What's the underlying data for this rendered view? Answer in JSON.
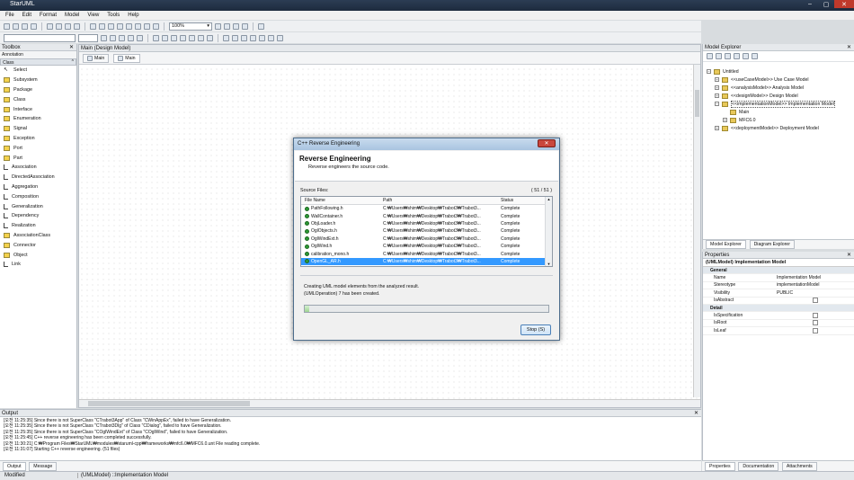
{
  "app": {
    "title": "StarUML"
  },
  "menu": [
    "File",
    "Edit",
    "Format",
    "Model",
    "View",
    "Tools",
    "Help"
  ],
  "zoom": "100%",
  "toolbox": {
    "title": "Toolbox",
    "section": "Annotation",
    "category": "Class",
    "items": [
      "Select",
      "Subsystem",
      "Package",
      "Class",
      "Interface",
      "Enumeration",
      "Signal",
      "Exception",
      "Port",
      "Part",
      "Association",
      "DirectedAssociation",
      "Aggregation",
      "Composition",
      "Generalization",
      "Dependency",
      "Realization",
      "AssociationClass",
      "Connector",
      "Object",
      "Link"
    ]
  },
  "editor": {
    "title": "Main (Design Model)",
    "tabs": [
      "Main",
      "Main"
    ]
  },
  "explorer": {
    "title": "Model Explorer",
    "tree": [
      {
        "label": "Untitled",
        "level": 0
      },
      {
        "label": "<<useCaseModel>> Use Case Model",
        "level": 1
      },
      {
        "label": "<<analysisModel>> Analysis Model",
        "level": 1
      },
      {
        "label": "<<designModel>> Design Model",
        "level": 1
      },
      {
        "label": "<<implementationModel>> Implementation Model",
        "level": 1
      },
      {
        "label": "Main",
        "level": 2
      },
      {
        "label": "MFC6.0",
        "level": 2
      },
      {
        "label": "<<deploymentModel>> Deployment Model",
        "level": 1
      }
    ],
    "tabs": [
      "Model Explorer",
      "Diagram Explorer"
    ]
  },
  "properties": {
    "title": "Properties",
    "header": "(UMLModel) Implementation Model",
    "general_label": "General",
    "detail_label": "Detail",
    "general": [
      {
        "k": "Name",
        "v": "Implementation Model"
      },
      {
        "k": "Stereotype",
        "v": "implementationModel"
      },
      {
        "k": "Visibility",
        "v": "PUBLIC"
      },
      {
        "k": "IsAbstract",
        "v": ""
      }
    ],
    "detail": [
      {
        "k": "IsSpecification",
        "v": ""
      },
      {
        "k": "IsRoot",
        "v": ""
      },
      {
        "k": "IsLeaf",
        "v": ""
      }
    ],
    "tabs": [
      "Properties",
      "Documentation",
      "Attachments"
    ]
  },
  "output": {
    "title": "Output",
    "lines": [
      "[오전 11:25:35]  Since there is not SuperClass \"CTrabot3App\" of Class \"CWinAppEx\", failed to have Generalization.",
      "[오전 11:25:35]  Since there is not SuperClass \"CTrabot3Dlg\" of Class \"CDialog\", failed to have Generalization.",
      "[오전 11:25:35]  Since there is not SuperClass \"COglWindExt\" of Class \"COglWind\", failed to have Generalization.",
      "[오전 11:25:45]  C++ reverse engineering has been completed successfully.",
      "[오전 11:30:21]  C:₩Program Files₩StarUML₩modules₩staruml-cpp₩frameworks₩mfc6.0₩MFC6.0.unt File reading complete.",
      "[오전 11:31:07]  Starting C++ reverse engineering. (51 files)"
    ],
    "tabs": [
      "Output",
      "Message"
    ]
  },
  "status": {
    "state": "Modified",
    "path": "(UMLModel) ::Implementation Model"
  },
  "dialog": {
    "title": "C++ Reverse Engineering",
    "heading": "Reverse Engineering",
    "subheading": "Reverse engineers the source code.",
    "source_label": "Source Files:",
    "count": "( 51 / 51 )",
    "columns": [
      "File Name",
      "Path",
      "Status"
    ],
    "files": [
      {
        "name": "PathFollowing.h",
        "path": "C:₩Users₩shim₩Desktop₩Trabot3₩Trabot3...",
        "status": "Complete"
      },
      {
        "name": "WallContainer.h",
        "path": "C:₩Users₩shim₩Desktop₩Trabot3₩Trabot3...",
        "status": "Complete"
      },
      {
        "name": "ObjLoader.h",
        "path": "C:₩Users₩shim₩Desktop₩Trabot3₩Trabot3...",
        "status": "Complete"
      },
      {
        "name": "OglObjects.h",
        "path": "C:₩Users₩shim₩Desktop₩Trabot3₩Trabot3...",
        "status": "Complete"
      },
      {
        "name": "OglWindExt.h",
        "path": "C:₩Users₩shim₩Desktop₩Trabot3₩Trabot3...",
        "status": "Complete"
      },
      {
        "name": "OglWind.h",
        "path": "C:₩Users₩shim₩Desktop₩Trabot3₩Trabot3...",
        "status": "Complete"
      },
      {
        "name": "calibration_mono.h",
        "path": "C:₩Users₩shim₩Desktop₩Trabot3₩Trabot3...",
        "status": "Complete"
      },
      {
        "name": "OpenGL_AR.h",
        "path": "C:₩Users₩shim₩Desktop₩Trabot3₩Trabot3...",
        "status": "Complete"
      }
    ],
    "selected_index": 7,
    "log": [
      "Creating UML model elements from the analyzed result.",
      "(UMLOperation) 7 has been created."
    ],
    "progress": 0.02,
    "stop_label": "Stop (S)"
  }
}
